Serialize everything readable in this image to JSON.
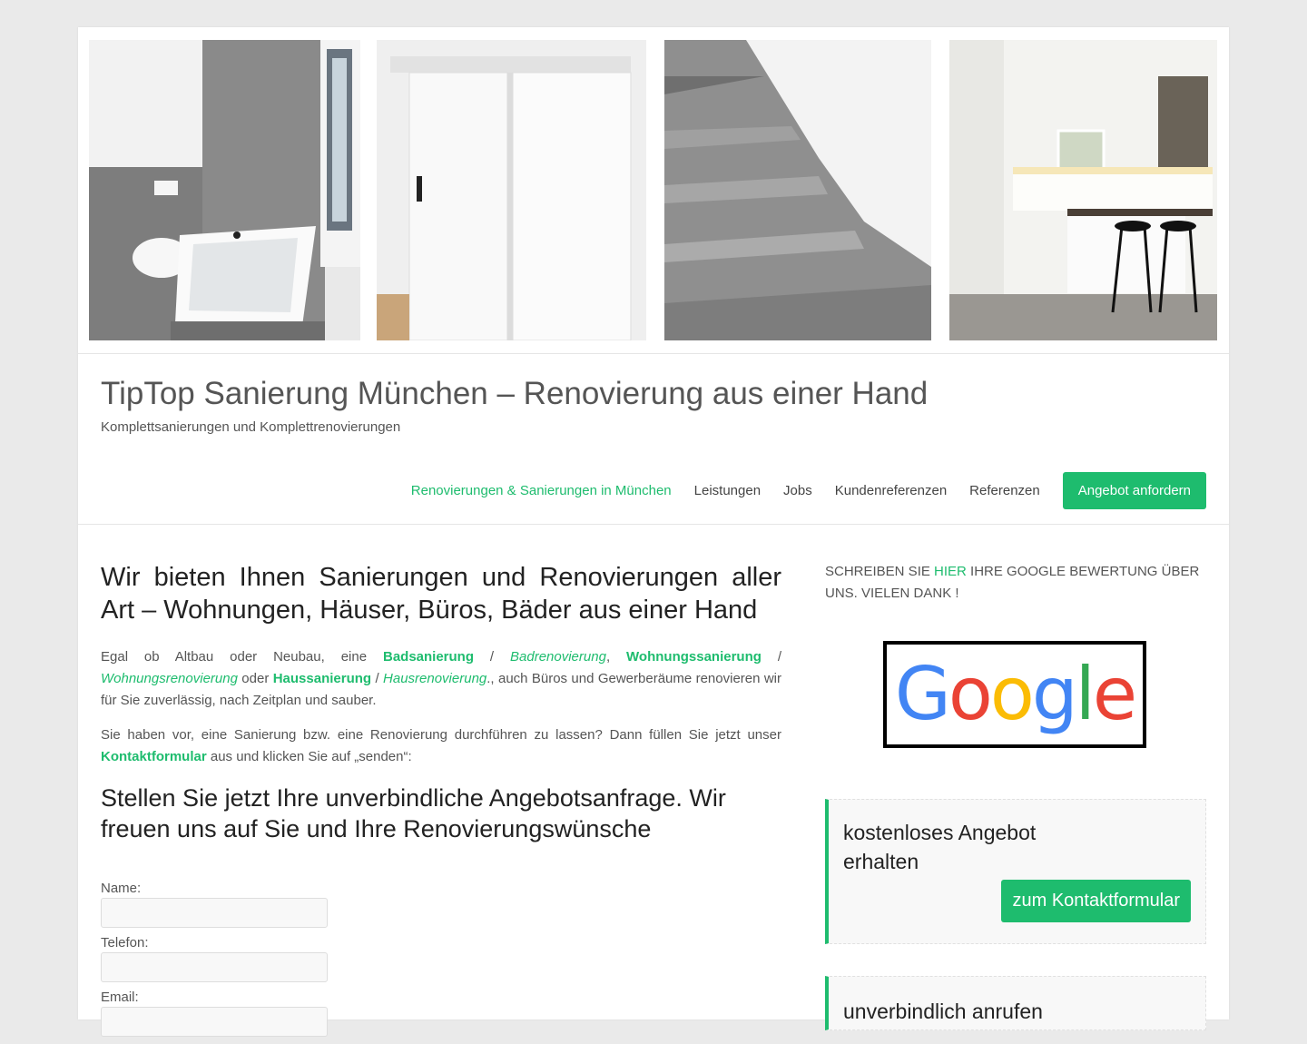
{
  "header": {
    "images": [
      "bathroom-photo",
      "sliding-door-photo",
      "staircase-photo",
      "kitchen-photo"
    ],
    "site_title": "TipTop Sanierung München – Renovierung aus einer Hand",
    "tagline": "Komplettsanierungen und Komplettrenovierungen"
  },
  "nav": {
    "items": [
      {
        "label": "Renovierungen & Sanierungen in München",
        "active": true
      },
      {
        "label": "Leistungen"
      },
      {
        "label": "Jobs"
      },
      {
        "label": "Kundenreferenzen"
      },
      {
        "label": "Referenzen"
      }
    ],
    "cta": "Angebot anfordern"
  },
  "main": {
    "heading": "Wir bieten Ihnen Sanierungen und Renovierungen aller Art  – Wohnungen, Häuser, Büros, Bäder aus einer Hand",
    "p1": {
      "t1": "Egal ob Altbau oder Neubau, eine ",
      "l1": "Badsanierung",
      "t2": " / ",
      "l2": "Badrenovierung",
      "t3": ", ",
      "l3": "Wohnungssanierung",
      "t4": " / ",
      "l4": "Wohnungsrenovierung",
      "t5": " oder ",
      "l5": "Haussanierung",
      "t6": " / ",
      "l6": "Hausrenovierung",
      "t7": "., auch Büros und Gewerberäume renovieren wir für Sie zuverlässig, nach Zeitplan und sauber."
    },
    "p2": {
      "t1": "Sie haben vor, eine Sanierung bzw. eine Renovierung durchführen zu lassen? Dann füllen Sie jetzt unser ",
      "link": "Kontaktformular",
      "t2": " aus und klicken Sie auf „senden“:"
    },
    "subheading": "Stellen Sie jetzt Ihre unverbindliche Angebotsanfrage. Wir freuen uns auf Sie und Ihre Renovierungswünsche",
    "form": {
      "name_label": "Name:",
      "phone_label": "Telefon:",
      "email_label": "Email:"
    }
  },
  "sidebar": {
    "review": {
      "before": "Schreiben Sie ",
      "link": "hier",
      "after": " Ihre Google Bewertung über uns. Vielen Dank !"
    },
    "google_logo": "Google",
    "widget1": {
      "title": "kostenloses Angebot erhalten",
      "button": "zum Kontaktformular"
    },
    "widget2": {
      "title": "unverbindlich anrufen"
    }
  },
  "colors": {
    "accent": "#1ebc6e",
    "google_blue": "#4285f4",
    "google_red": "#ea4335",
    "google_yellow": "#fbbc05",
    "google_green": "#34a853"
  }
}
